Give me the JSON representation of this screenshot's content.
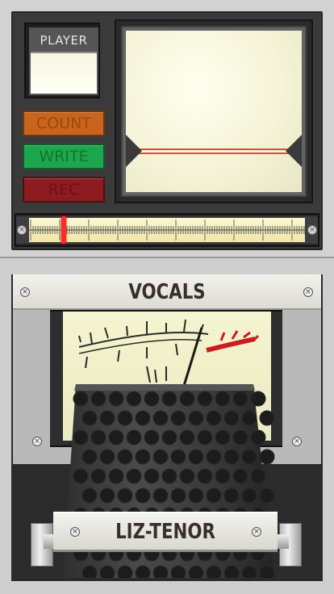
{
  "player": {
    "label": "PLAYER"
  },
  "buttons": {
    "count": "COUNT",
    "write": "WRITE",
    "rec": "REC"
  },
  "channel": {
    "title": "VOCALS",
    "preset": "LIZ-TENOR"
  },
  "colors": {
    "count": "#c8641c",
    "write": "#1ea64c",
    "rec": "#8c1c20",
    "playhead": "#ff2a2a",
    "trace": "#e04a3a",
    "meter_red_zone": "#c81e1e"
  },
  "icons": {
    "scope_left_marker": "triangle-right",
    "scope_right_marker": "triangle-left",
    "track_left_screw": "screw",
    "track_right_screw": "screw"
  }
}
